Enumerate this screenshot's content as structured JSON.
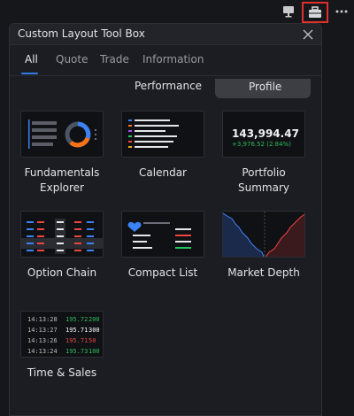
{
  "toolbar": {
    "monitor_icon": "monitor-icon",
    "toolbox_icon": "toolbox-icon",
    "more_icon": "more-horizontal-icon"
  },
  "panel": {
    "title": "Custom Layout Tool Box",
    "close_icon": "close-icon"
  },
  "tabs": [
    {
      "label": "All",
      "active": true
    },
    {
      "label": "Quote",
      "active": false
    },
    {
      "label": "Trade",
      "active": false
    },
    {
      "label": "Information",
      "active": false
    }
  ],
  "categories": {
    "performance": "Performance",
    "profile": "Profile"
  },
  "tools": [
    {
      "label": "Fundamentals\nExplorer"
    },
    {
      "label": "Calendar"
    },
    {
      "label": "Portfolio\nSummary",
      "thumb_value": "143,994.47",
      "thumb_change": "+3,976.52 (2.84%)"
    },
    {
      "label": "Option Chain"
    },
    {
      "label": "Compact List"
    },
    {
      "label": "Market Depth"
    },
    {
      "label": "Time & Sales"
    }
  ],
  "time_sales_preview": [
    {
      "time": "14:13:28",
      "price": "195.72",
      "size": "200",
      "price_color": "green",
      "size_color": "green"
    },
    {
      "time": "14:13:27",
      "price": "195.71",
      "size": "300",
      "price_color": "white",
      "size_color": "white"
    },
    {
      "time": "14:13:26",
      "price": "195.71",
      "size": "50",
      "price_color": "red",
      "size_color": "red"
    },
    {
      "time": "14:13:24",
      "price": "195.73",
      "size": "100",
      "price_color": "green",
      "size_color": "green"
    }
  ],
  "colors": {
    "accent": "#2f7ee8",
    "highlight_border": "#e0302d",
    "up": "#2dbd5e",
    "down": "#e04646"
  }
}
